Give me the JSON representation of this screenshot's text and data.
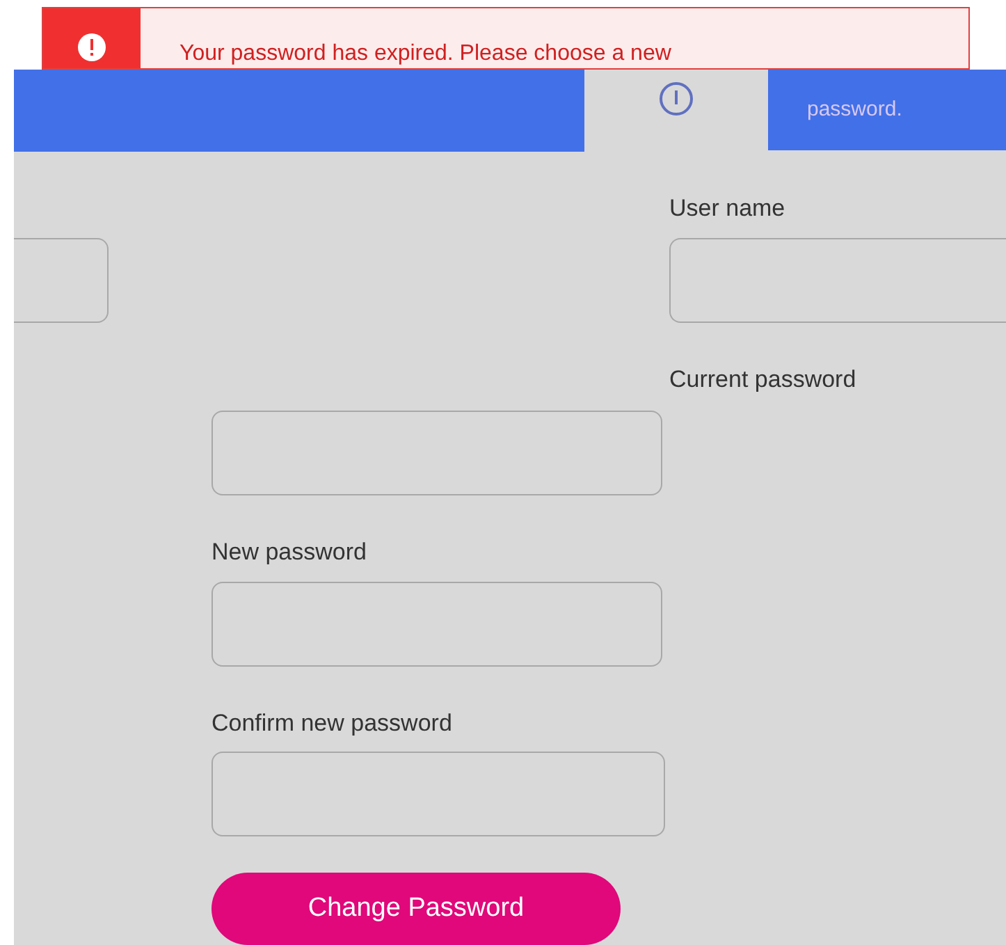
{
  "alert": {
    "message": "Your password has expired. Please choose a new",
    "continuation": "password."
  },
  "fields": [
    {
      "label": "User name"
    },
    {
      "label": "Current password"
    },
    {
      "label": "New password"
    },
    {
      "label": "Confirm new password"
    }
  ],
  "submit_button": "Change Password"
}
